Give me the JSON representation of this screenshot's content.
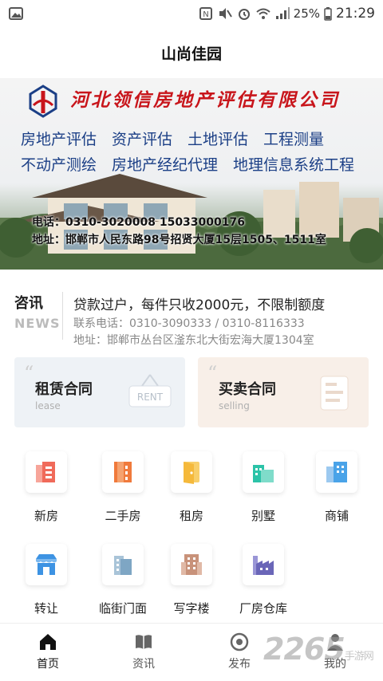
{
  "status_bar": {
    "battery": "25%",
    "time": "21:29"
  },
  "app_bar": {
    "title": "山尚佳园"
  },
  "banner": {
    "company": "河北领信房地产评估有限公司",
    "services_row1": [
      "房地产评估",
      "资产评估",
      "土地评估",
      "工程测量"
    ],
    "services_row2": [
      "不动产测绘",
      "房地产经纪代理",
      "地理信息系统工程"
    ],
    "phone_line": "电话：0310-3020008  15033000176",
    "address_line": "地址：邯郸市人民东路98号招贤大厦15层1505、1511室"
  },
  "news": {
    "logo_top": "咨讯",
    "logo_bottom": "NEWS",
    "headline": "贷款过户，每件只收2000元，不限制额度",
    "phone": "联系电话：0310-3090333 / 0310-8116333",
    "address": "地址：邯郸市丛台区滏东北大街宏海大厦1304室"
  },
  "contracts": [
    {
      "title": "租赁合同",
      "subtitle": "lease",
      "tag": "RENT"
    },
    {
      "title": "买卖合同",
      "subtitle": "selling"
    }
  ],
  "categories": [
    {
      "label": "新房",
      "icon": "new-house-icon",
      "color": "#f06a5a"
    },
    {
      "label": "二手房",
      "icon": "second-hand-house-icon",
      "color": "#f07a3c"
    },
    {
      "label": "租房",
      "icon": "rent-door-icon",
      "color": "#f5b93b"
    },
    {
      "label": "别墅",
      "icon": "villa-icon",
      "color": "#2cc3a8"
    },
    {
      "label": "商铺",
      "icon": "shop-building-icon",
      "color": "#4aa3e8"
    },
    {
      "label": "转让",
      "icon": "transfer-store-icon",
      "color": "#3d93e3"
    },
    {
      "label": "临街门面",
      "icon": "storefront-icon",
      "color": "#7ea6c4"
    },
    {
      "label": "写字楼",
      "icon": "office-building-icon",
      "color": "#c8927a"
    },
    {
      "label": "厂房仓库",
      "icon": "factory-icon",
      "color": "#6a66b8"
    }
  ],
  "tabs": [
    {
      "label": "首页",
      "icon": "home-icon"
    },
    {
      "label": "资讯",
      "icon": "book-icon"
    },
    {
      "label": "发布",
      "icon": "publish-icon"
    },
    {
      "label": "我的",
      "icon": "user-icon"
    }
  ],
  "watermark": {
    "main": "2265",
    "sub": "手游网"
  },
  "colors": {
    "brand_red": "#c8151b",
    "service_blue": "#1b3f86"
  }
}
